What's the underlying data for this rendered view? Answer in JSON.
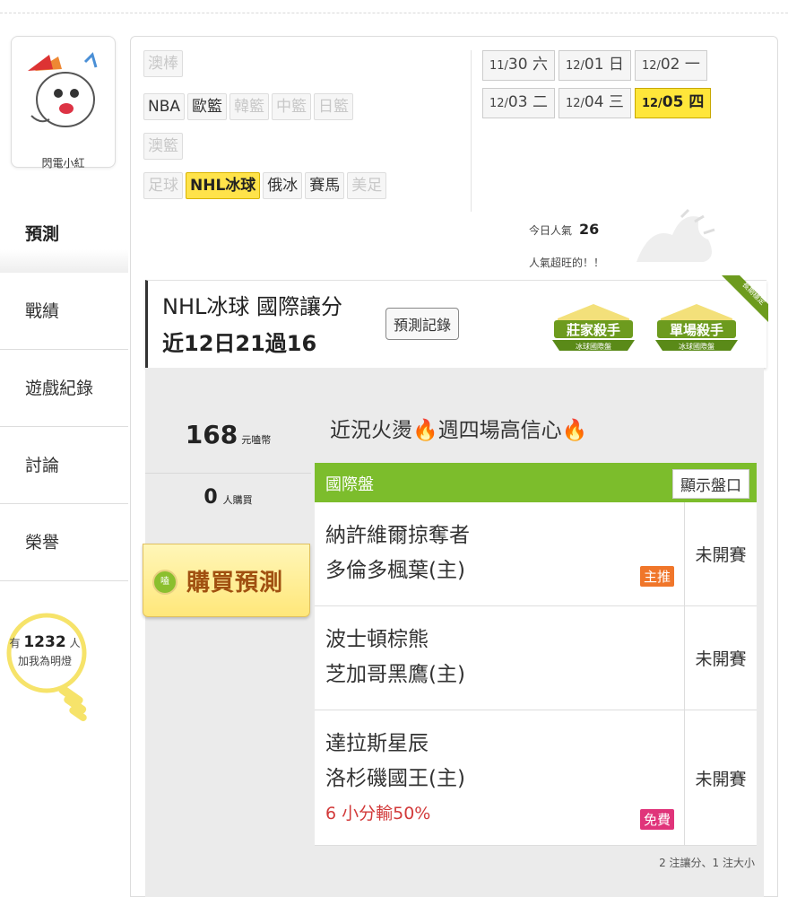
{
  "user": {
    "name": "閃電小紅"
  },
  "nav": [
    "預測",
    "戰績",
    "遊戲紀錄",
    "討論",
    "榮譽"
  ],
  "fans": {
    "prefix": "有",
    "count": "1232",
    "suffix": "人",
    "caption": "加我為明燈"
  },
  "sports": {
    "row1": [
      {
        "label": "澳棒",
        "state": "dim"
      }
    ],
    "row2": [
      {
        "label": "NBA",
        "state": "on"
      },
      {
        "label": "歐籃",
        "state": "on"
      },
      {
        "label": "韓籃",
        "state": "dim"
      },
      {
        "label": "中籃",
        "state": "dim"
      },
      {
        "label": "日籃",
        "state": "dim"
      }
    ],
    "row3": [
      {
        "label": "澳籃",
        "state": "dim"
      }
    ],
    "row4": [
      {
        "label": "足球",
        "state": "dim"
      },
      {
        "label": "NHL冰球",
        "state": "sel"
      },
      {
        "label": "俄冰",
        "state": "on"
      },
      {
        "label": "賽馬",
        "state": "on"
      },
      {
        "label": "美足",
        "state": "dim"
      }
    ]
  },
  "dates": [
    {
      "mo": "11/",
      "day": "30 六",
      "sel": false
    },
    {
      "mo": "12/",
      "day": "01 日",
      "sel": false
    },
    {
      "mo": "12/",
      "day": "02 一",
      "sel": false
    },
    {
      "mo": "12/",
      "day": "03 二",
      "sel": false
    },
    {
      "mo": "12/",
      "day": "04 三",
      "sel": false
    },
    {
      "mo": "12/",
      "day": "05 四",
      "sel": true
    }
  ],
  "popularity": {
    "label": "今日人氣",
    "value": "26",
    "note": "人氣超旺的！！"
  },
  "header": {
    "title": "NHL冰球 國際讓分",
    "record": "近12日21過16",
    "record_button": "預測記錄",
    "badge1_title": "莊家殺手",
    "badge1_sub": "冰球國際盤",
    "badge2_title": "單場殺手",
    "badge2_sub": "冰球國際盤",
    "ribbon": "長期穩定"
  },
  "purchase": {
    "price": "168",
    "price_unit": "元嗑幣",
    "buyers": "0",
    "buyers_unit": "人購買",
    "button": "購買預測",
    "coin_text": "嗑"
  },
  "headline": "近況火燙🔥週四場高信心🔥",
  "panel": {
    "title": "國際盤",
    "show_button": "顯示盤口"
  },
  "games": [
    {
      "away": "納許維爾掠奪者",
      "home": "多倫多楓葉(主)",
      "status": "未開賽",
      "tag": "主推",
      "tag_color": "#f0762a",
      "note": ""
    },
    {
      "away": "波士頓棕熊",
      "home": "芝加哥黑鷹(主)",
      "status": "未開賽",
      "tag": "",
      "tag_color": "",
      "note": ""
    },
    {
      "away": "達拉斯星辰",
      "home": "洛杉磯國王(主)",
      "status": "未開賽",
      "tag": "免費",
      "tag_color": "#e0347a",
      "note": "6 小分輸50%"
    }
  ],
  "footer_note": "2 注讓分、1 注大小"
}
